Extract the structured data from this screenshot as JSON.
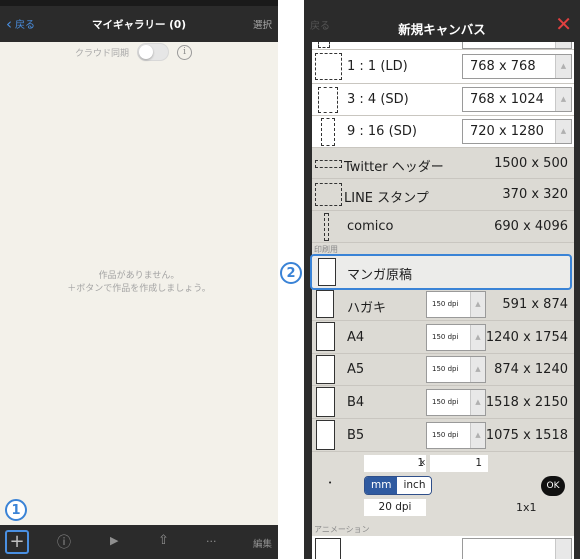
{
  "left": {
    "nav": {
      "back_label": "戻る",
      "title": "マイギャラリー (0)",
      "select_label": "選択"
    },
    "cloud_sync_label": "クラウド同期",
    "info_glyph": "i",
    "empty_line1": "作品がありません。",
    "empty_line2": "＋ボタンで作品を作成しましょう。",
    "toolbar": {
      "add_glyph": "+",
      "info_glyph": "ⓘ",
      "play_glyph": "▶",
      "share_glyph": "⇧",
      "more_glyph": "···",
      "edit_label": "編集"
    },
    "marker_1": "1"
  },
  "right": {
    "nav": {
      "back_label": "戻る",
      "title": "新規キャンバス",
      "close_glyph": "✕"
    },
    "presets": [
      {
        "label": "1 : 1 (LD)",
        "size": "768 x 768"
      },
      {
        "label": "3 : 4 (SD)",
        "size": "768 x 1024"
      },
      {
        "label": "9 : 16 (SD)",
        "size": "720 x 1280"
      }
    ],
    "social": [
      {
        "label": "Twitter ヘッダー",
        "size": "1500 x 500"
      },
      {
        "label": "LINE スタンプ",
        "size": "370 x 320"
      },
      {
        "label": "comico",
        "size": "690 x 4096"
      }
    ],
    "print_section": "印刷用",
    "manga_label": "マンガ原稿",
    "print_rows": [
      {
        "label": "ハガキ",
        "dpi": "150 dpi",
        "size": "591 x 874"
      },
      {
        "label": "A4",
        "dpi": "150 dpi",
        "size": "1240 x 1754"
      },
      {
        "label": "A5",
        "dpi": "150 dpi",
        "size": "874 x 1240"
      },
      {
        "label": "B4",
        "dpi": "150 dpi",
        "size": "1518 x 2150"
      },
      {
        "label": "B5",
        "dpi": "150 dpi",
        "size": "1075 x 1518"
      }
    ],
    "custom": {
      "width_value": "1",
      "times": "x",
      "height_value": "1",
      "bullet": "•",
      "unit_mm": "mm",
      "unit_inch": "inch",
      "ok_label": "OK",
      "dpi_value": "20 dpi",
      "ratio": "1x1"
    },
    "anim_section": "アニメーション",
    "marker_2": "2"
  },
  "colors": {
    "accent": "#3a83d6",
    "close_red": "#e24040",
    "dark_bar": "#2b2b2b"
  }
}
